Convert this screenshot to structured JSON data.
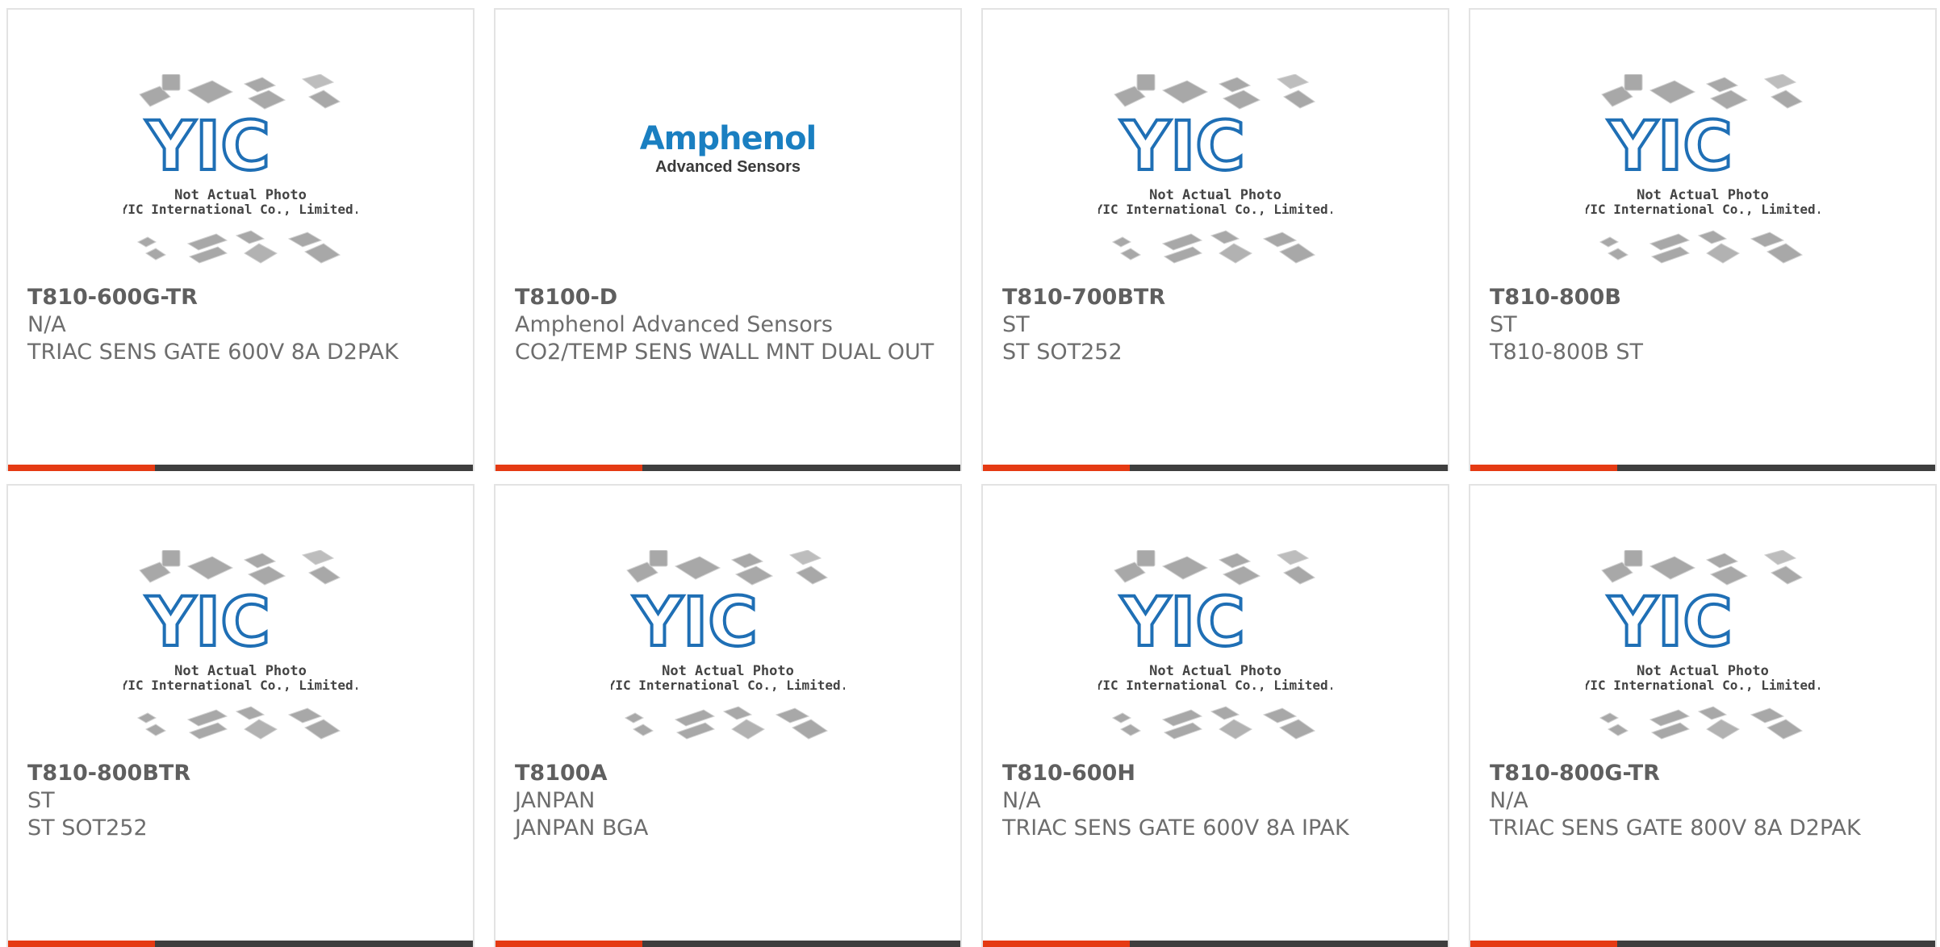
{
  "products": [
    {
      "part": "T810-600G-TR",
      "maker": "N/A",
      "desc": "TRIAC SENS GATE 600V 8A D2PAK",
      "image": "placeholder"
    },
    {
      "part": "T8100-D",
      "maker": "Amphenol Advanced Sensors",
      "desc": "CO2/TEMP SENS WALL MNT DUAL OUT",
      "image": "amphenol"
    },
    {
      "part": "T810-700BTR",
      "maker": "ST",
      "desc": "ST SOT252",
      "image": "placeholder"
    },
    {
      "part": "T810-800B",
      "maker": "ST",
      "desc": "T810-800B ST",
      "image": "placeholder"
    },
    {
      "part": "T810-800BTR",
      "maker": "ST",
      "desc": "ST SOT252",
      "image": "placeholder"
    },
    {
      "part": "T8100A",
      "maker": "JANPAN",
      "desc": "JANPAN BGA",
      "image": "placeholder"
    },
    {
      "part": "T810-600H",
      "maker": "N/A",
      "desc": "TRIAC SENS GATE 600V 8A IPAK",
      "image": "placeholder"
    },
    {
      "part": "T810-800G-TR",
      "maker": "N/A",
      "desc": "TRIAC SENS GATE 800V 8A D2PAK",
      "image": "placeholder"
    }
  ],
  "placeholder": {
    "logo": "YIC",
    "line1": "Not Actual Photo",
    "line2": "YIC International Co., Limited."
  },
  "amphenol_logo": {
    "brand": "Amphenol",
    "sub": "Advanced Sensors"
  },
  "colors": {
    "accent": "#e53a13",
    "bar": "#3e3e3e",
    "yic_blue": "#1f6fb5",
    "brand_blue": "#1a7fc1"
  }
}
